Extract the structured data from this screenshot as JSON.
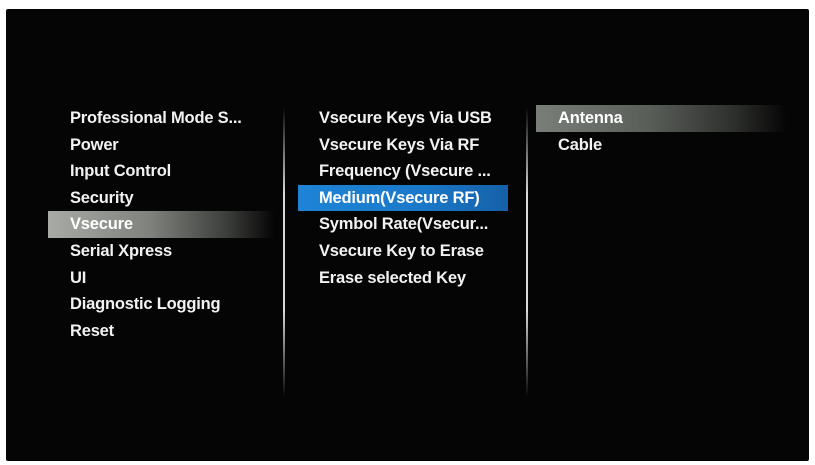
{
  "menu": {
    "level1": {
      "items": [
        {
          "label": "Professional Mode S..."
        },
        {
          "label": "Power"
        },
        {
          "label": "Input Control"
        },
        {
          "label": "Security"
        },
        {
          "label": "Vsecure"
        },
        {
          "label": "Serial Xpress"
        },
        {
          "label": "UI"
        },
        {
          "label": "Diagnostic Logging"
        },
        {
          "label": "Reset"
        }
      ],
      "selected": "Vsecure"
    },
    "level2": {
      "items": [
        {
          "label": "Vsecure Keys Via USB"
        },
        {
          "label": "Vsecure Keys Via RF"
        },
        {
          "label": "Frequency (Vsecure ..."
        },
        {
          "label": "Medium(Vsecure RF)"
        },
        {
          "label": "Symbol Rate(Vsecur..."
        },
        {
          "label": "Vsecure Key to Erase"
        },
        {
          "label": "Erase selected Key"
        }
      ],
      "focused": "Medium(Vsecure RF)"
    },
    "level3": {
      "items": [
        {
          "label": "Antenna"
        },
        {
          "label": "Cable"
        }
      ],
      "selected": "Antenna"
    }
  },
  "colors": {
    "background": "#050505",
    "text": "#f2f2f2",
    "focus_highlight": "#1f84d6",
    "selection_highlight": "#a8aba5"
  }
}
